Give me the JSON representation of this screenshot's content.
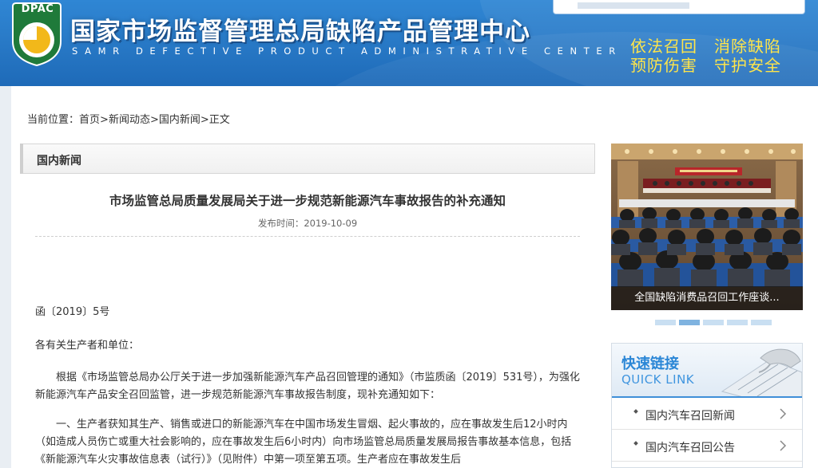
{
  "header": {
    "logo_text": "DPAC",
    "title": "国家市场监督管理总局缺陷产品管理中心",
    "subtitle": "SAMR DEFECTIVE PRODUCT ADMINISTRATIVE CENTER",
    "slogan_line1": "依法召回　消除缺陷",
    "slogan_line2": "预防伤害　守护安全",
    "colors": {
      "header_bg": "#2a7cc9",
      "slogan": "#ffe54a"
    }
  },
  "breadcrumb": {
    "prefix": "当前位置：",
    "items": [
      "首页",
      "新闻动态",
      "国内新闻",
      "正文"
    ],
    "separator": ">"
  },
  "section": {
    "label": "国内新闻"
  },
  "article": {
    "title": "市场监管总局质量发展局关于进一步规范新能源汽车事故报告的补充通知",
    "publish_time": "发布时间：2019-10-09",
    "doc_number": "函〔2019〕5号",
    "addressee": "各有关生产者和单位：",
    "paragraph1": "根据《市场监管总局办公厅关于进一步加强新能源汽车产品召回管理的通知》（市监质函〔2019〕531号），为强化新能源汽车产品安全召回监管，进一步规范新能源汽车事故报告制度，现补充通知如下：",
    "paragraph2": "一、生产者获知其生产、销售或进口的新能源汽车在中国市场发生冒烟、起火事故的，应在事故发生后12小时内（如造成人员伤亡或重大社会影响的，应在事故发生后6小时内）向市场监管总局质量发展局报告事故基本信息，包括《新能源汽车火灾事故信息表（试行）》（见附件）中第一项至第五项。生产者应在事故发生后"
  },
  "slideshow": {
    "caption": "全国缺陷消费品召回工作座谈...",
    "dot_count": 5,
    "active_dot": 2
  },
  "quick_links": {
    "title": "快速链接",
    "subtitle": "QUICK LINK",
    "items": [
      "国内汽车召回新闻",
      "国内汽车召回公告"
    ]
  }
}
